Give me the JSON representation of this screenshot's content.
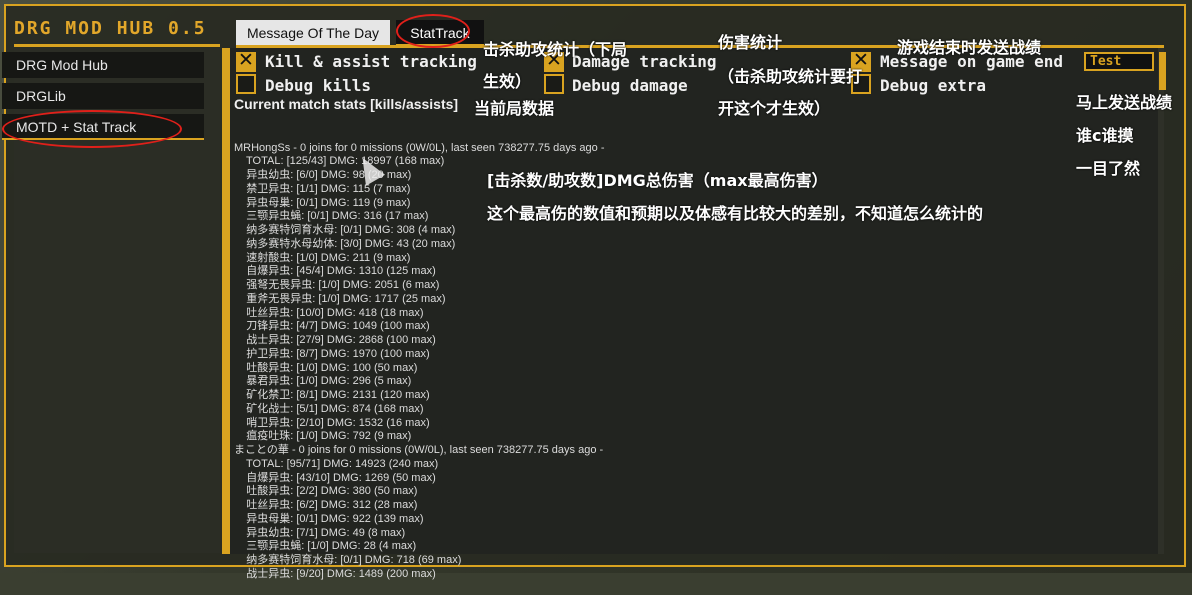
{
  "app": {
    "title": "DRG MOD HUB 0.5"
  },
  "sidebar": {
    "items": [
      {
        "label": "DRG Mod Hub"
      },
      {
        "label": "DRGLib"
      },
      {
        "label": "MOTD + Stat Track"
      }
    ]
  },
  "tabs": [
    {
      "label": "Message Of The Day"
    },
    {
      "label": "StatTrack"
    }
  ],
  "options": {
    "kill_tracking": {
      "label": "Kill & assist tracking",
      "checked": true
    },
    "debug_kills": {
      "label": "Debug kills",
      "checked": false
    },
    "damage_tracking": {
      "label": "Damage tracking",
      "checked": true
    },
    "debug_damage": {
      "label": "Debug damage",
      "checked": false
    },
    "message_end": {
      "label": "Message on game end",
      "checked": true
    },
    "debug_extra": {
      "label": "Debug extra",
      "checked": false
    },
    "test_button": "Test"
  },
  "stats": {
    "title": "Current match stats [kills/assists]",
    "lines": [
      "MRHongSs - 0 joins for 0 missions (0W/0L), last seen 738277.75 days ago -",
      "    TOTAL: [125/43] DMG: 18997 (168 max)",
      "    异虫幼虫: [6/0] DMG: 98 (20 max)",
      "    禁卫异虫: [1/1] DMG: 115 (7 max)",
      "    异虫母巢: [0/1] DMG: 119 (9 max)",
      "    三颚异虫蝇: [0/1] DMG: 316 (17 max)",
      "    纳多赛特饲育水母: [0/1] DMG: 308 (4 max)",
      "    纳多赛特水母幼体: [3/0] DMG: 43 (20 max)",
      "    速射酸虫: [1/0] DMG: 211 (9 max)",
      "    自爆异虫: [45/4] DMG: 1310 (125 max)",
      "    强弩无畏异虫: [1/0] DMG: 2051 (6 max)",
      "    重斧无畏异虫: [1/0] DMG: 1717 (25 max)",
      "    吐丝异虫: [10/0] DMG: 418 (18 max)",
      "    刀锋异虫: [4/7] DMG: 1049 (100 max)",
      "    战士异虫: [27/9] DMG: 2868 (100 max)",
      "    护卫异虫: [8/7] DMG: 1970 (100 max)",
      "    吐酸异虫: [1/0] DMG: 100 (50 max)",
      "    暴君异虫: [1/0] DMG: 296 (5 max)",
      "    矿化禁卫: [8/1] DMG: 2131 (120 max)",
      "    矿化战士: [5/1] DMG: 874 (168 max)",
      "    哨卫异虫: [2/10] DMG: 1532 (16 max)",
      "    瘟疫吐珠: [1/0] DMG: 792 (9 max)",
      "まことの華 - 0 joins for 0 missions (0W/0L), last seen 738277.75 days ago -",
      "    TOTAL: [95/71] DMG: 14923 (240 max)",
      "    自爆异虫: [43/10] DMG: 1269 (50 max)",
      "    吐酸异虫: [2/2] DMG: 380 (50 max)",
      "    吐丝异虫: [6/2] DMG: 312 (28 max)",
      "    异虫母巢: [0/1] DMG: 922 (139 max)",
      "    异虫幼虫: [7/1] DMG: 49 (8 max)",
      "    三颚异虫蝇: [1/0] DMG: 28 (4 max)",
      "    纳多赛特饲育水母: [0/1] DMG: 718 (69 max)",
      "    战士异虫: [9/20] DMG: 1489 (200 max)"
    ]
  },
  "annotations": {
    "kills_1": "击杀助攻统计（下局",
    "kills_2": "生效）",
    "current": "当前局数据",
    "damage_1": "伤害统计",
    "damage_2": "（击杀助攻统计要打",
    "damage_3": "开这个才生效）",
    "end_msg": "游戏结束时发送战绩",
    "send_now": "马上发送战绩",
    "who_slack": "谁c谁摸",
    "clear": "一目了然",
    "format": "[击杀数/助攻数]DMG总伤害（max最高伤害）",
    "note": "这个最高伤的数值和预期以及体感有比较大的差别，不知道怎么统计的"
  }
}
